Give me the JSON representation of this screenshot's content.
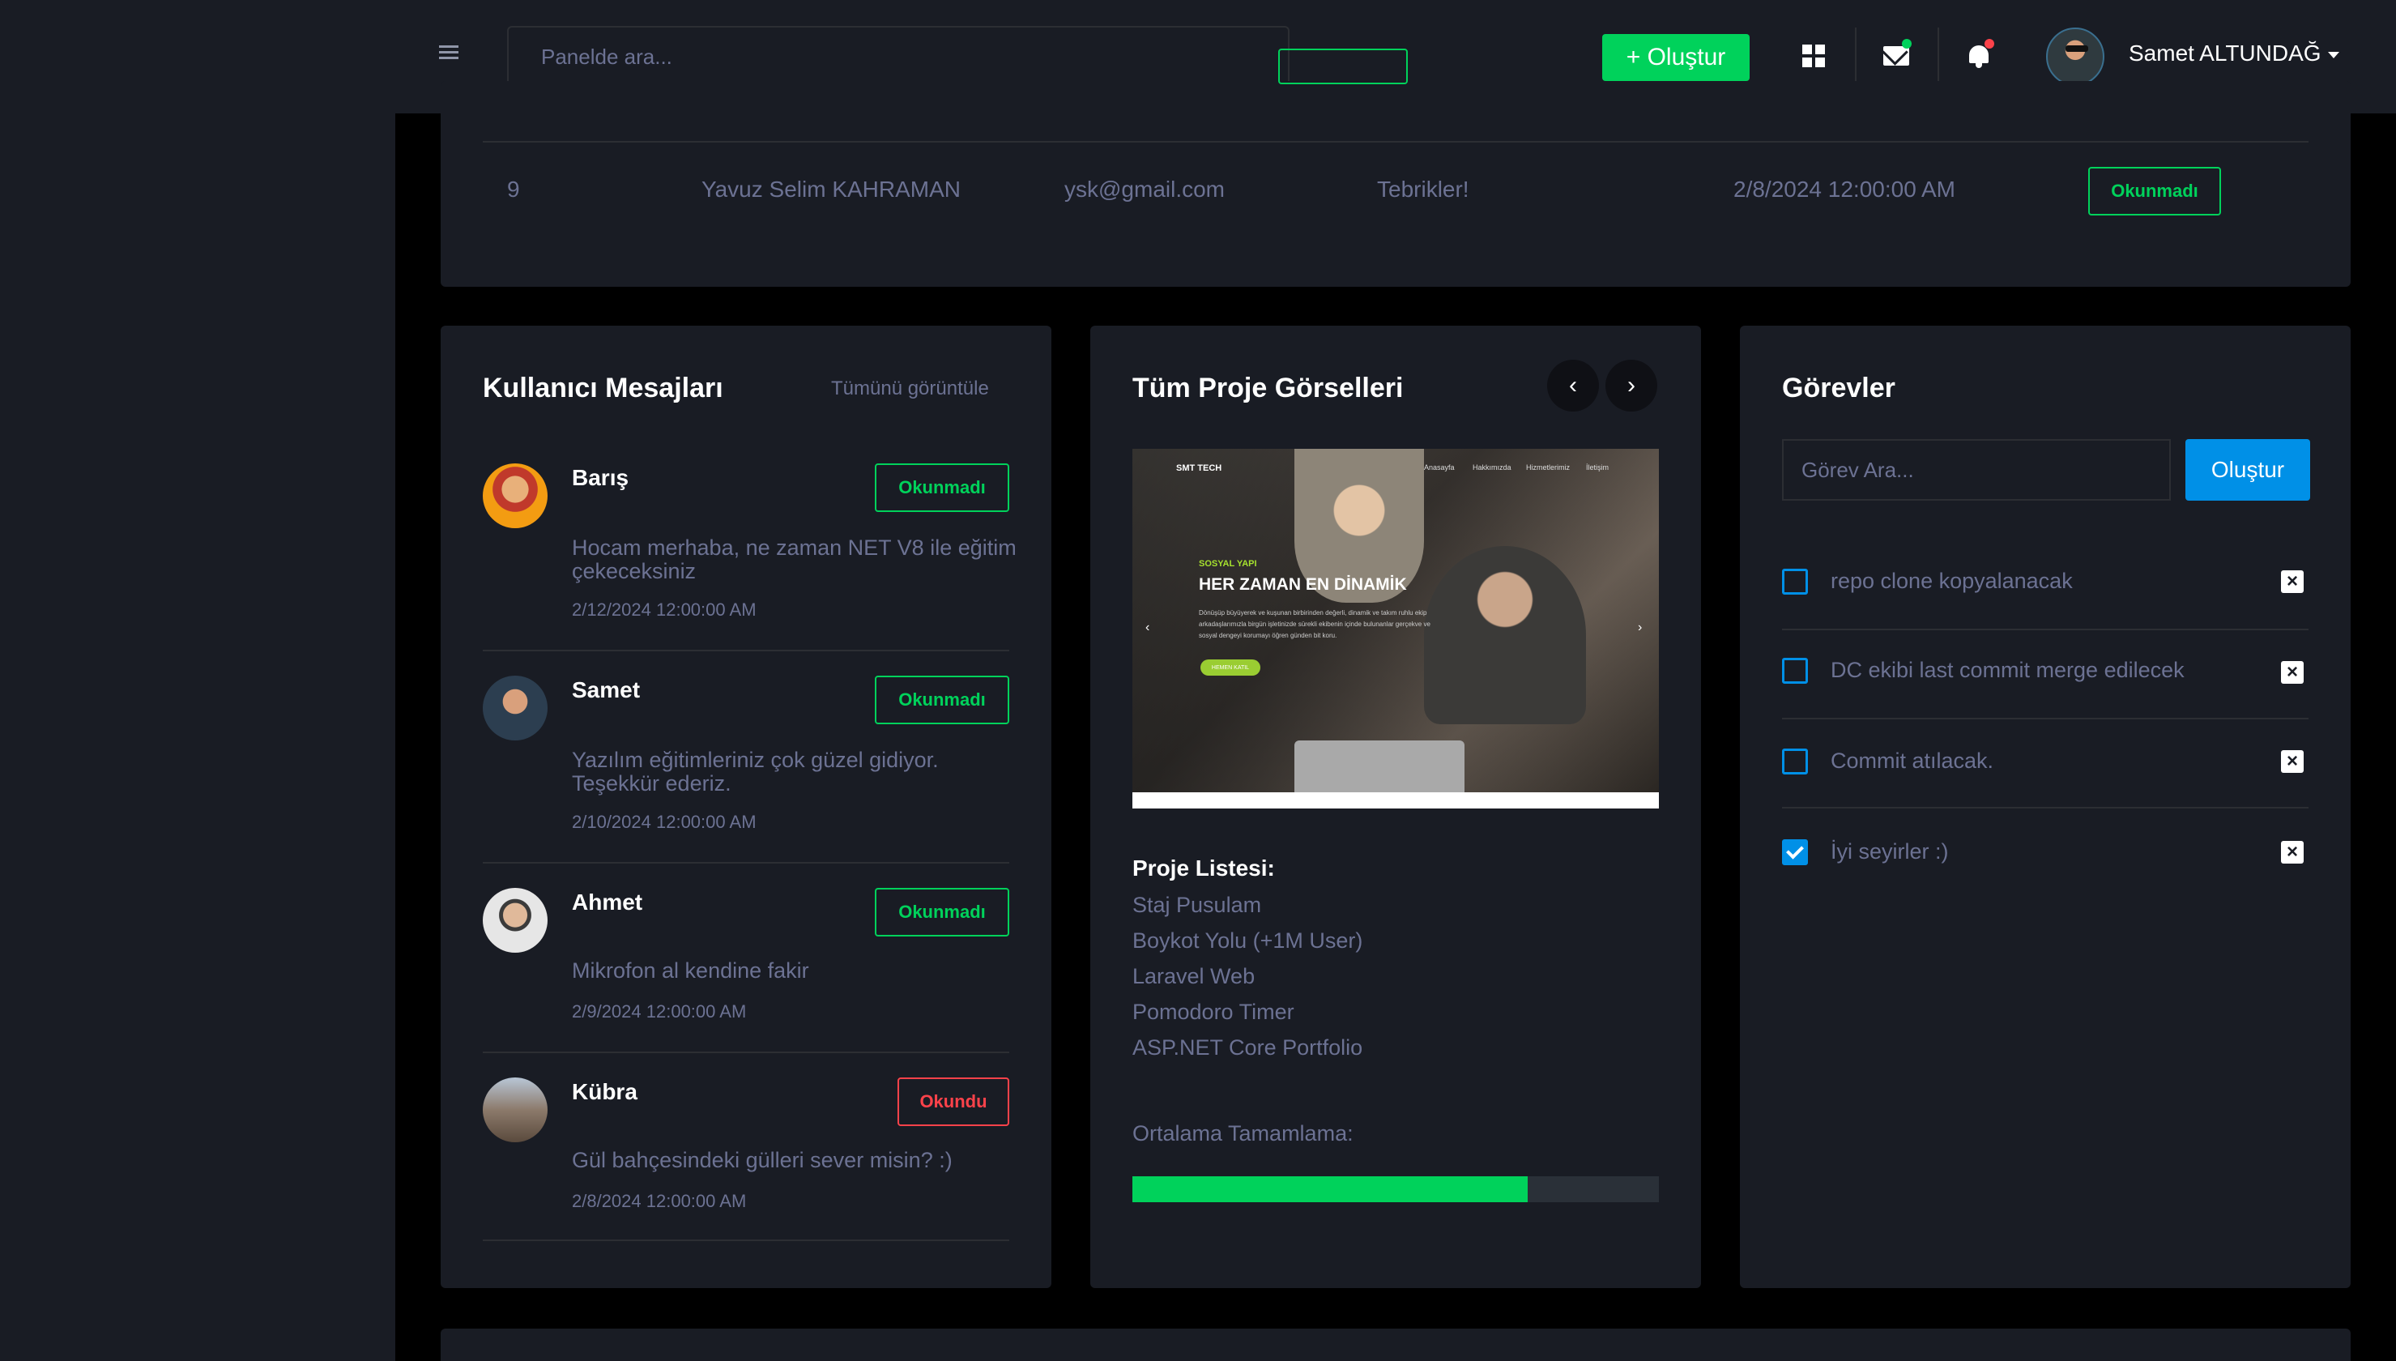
{
  "topbar": {
    "search_placeholder": "Panelde ara...",
    "create_label": "+ Oluştur",
    "user_name": "Samet ALTUNDAĞ",
    "icons": [
      "menu-icon",
      "apps-grid-icon",
      "mail-icon",
      "bell-icon"
    ],
    "colors": {
      "create": "#00d25b",
      "mail_dot": "#00d25b",
      "bell_dot": "#fc424a"
    }
  },
  "table": {
    "row": {
      "id": "9",
      "name": "Yavuz Selim KAHRAMAN",
      "email": "ysk@gmail.com",
      "subject": "Tebrikler!",
      "date": "2/8/2024 12:00:00 AM",
      "status": "Okunmadı"
    }
  },
  "messages": {
    "title": "Kullanıcı Mesajları",
    "view_all": "Tümünü görüntüle",
    "items": [
      {
        "name": "Barış",
        "text": "Hocam merhaba, ne zaman NET V8 ile eğitim çekeceksiniz",
        "date": "2/12/2024 12:00:00 AM",
        "status": "Okunmadı",
        "status_color": "green"
      },
      {
        "name": "Samet",
        "text": "Yazılım eğitimleriniz çok güzel gidiyor. Teşekkür ederiz.",
        "date": "2/10/2024 12:00:00 AM",
        "status": "Okunmadı",
        "status_color": "green"
      },
      {
        "name": "Ahmet",
        "text": "Mikrofon al kendine fakir",
        "date": "2/9/2024 12:00:00 AM",
        "status": "Okunmadı",
        "status_color": "green"
      },
      {
        "name": "Kübra",
        "text": "Gül bahçesindeki gülleri sever misin? :)",
        "date": "2/8/2024 12:00:00 AM",
        "status": "Okundu",
        "status_color": "red"
      }
    ]
  },
  "projects": {
    "title": "Tüm Proje Görselleri",
    "slide": {
      "brand": "SMT TECH",
      "nav": [
        "Anasayfa",
        "Hakkımızda",
        "Hizmetlerimiz",
        "İletişim"
      ],
      "subtitle": "SOSYAL YAPI",
      "headline": "HER ZAMAN EN DİNAMİK",
      "paragraph": "Dönüşüp büyüyerek ve kuşunan birbirinden değerli, dinamik ve takım ruhlu ekip arkadaşlarımızla birgün işletinizde sürekli ekibenin içinde bulunanlar gerçekve ve sosyal dengeyi korumayı öğren günden bit koru.",
      "button": "HEMEN KATIL"
    },
    "list_title": "Proje Listesi:",
    "list": [
      "Staj Pusulam",
      "Boykot Yolu (+1M User)",
      "Laravel Web",
      "Pomodoro Timer",
      "ASP.NET Core Portfolio"
    ],
    "average_label": "Ortalama Tamamlama:",
    "average_completion": 0.75
  },
  "tasks": {
    "title": "Görevler",
    "search_placeholder": "Görev Ara...",
    "create_label": "Oluştur",
    "items": [
      {
        "text": "repo clone kopyalanacak",
        "done": false
      },
      {
        "text": "DC ekibi last commit merge edilecek",
        "done": false
      },
      {
        "text": "Commit atılacak.",
        "done": false
      },
      {
        "text": "İyi seyirler :)",
        "done": true
      }
    ]
  }
}
